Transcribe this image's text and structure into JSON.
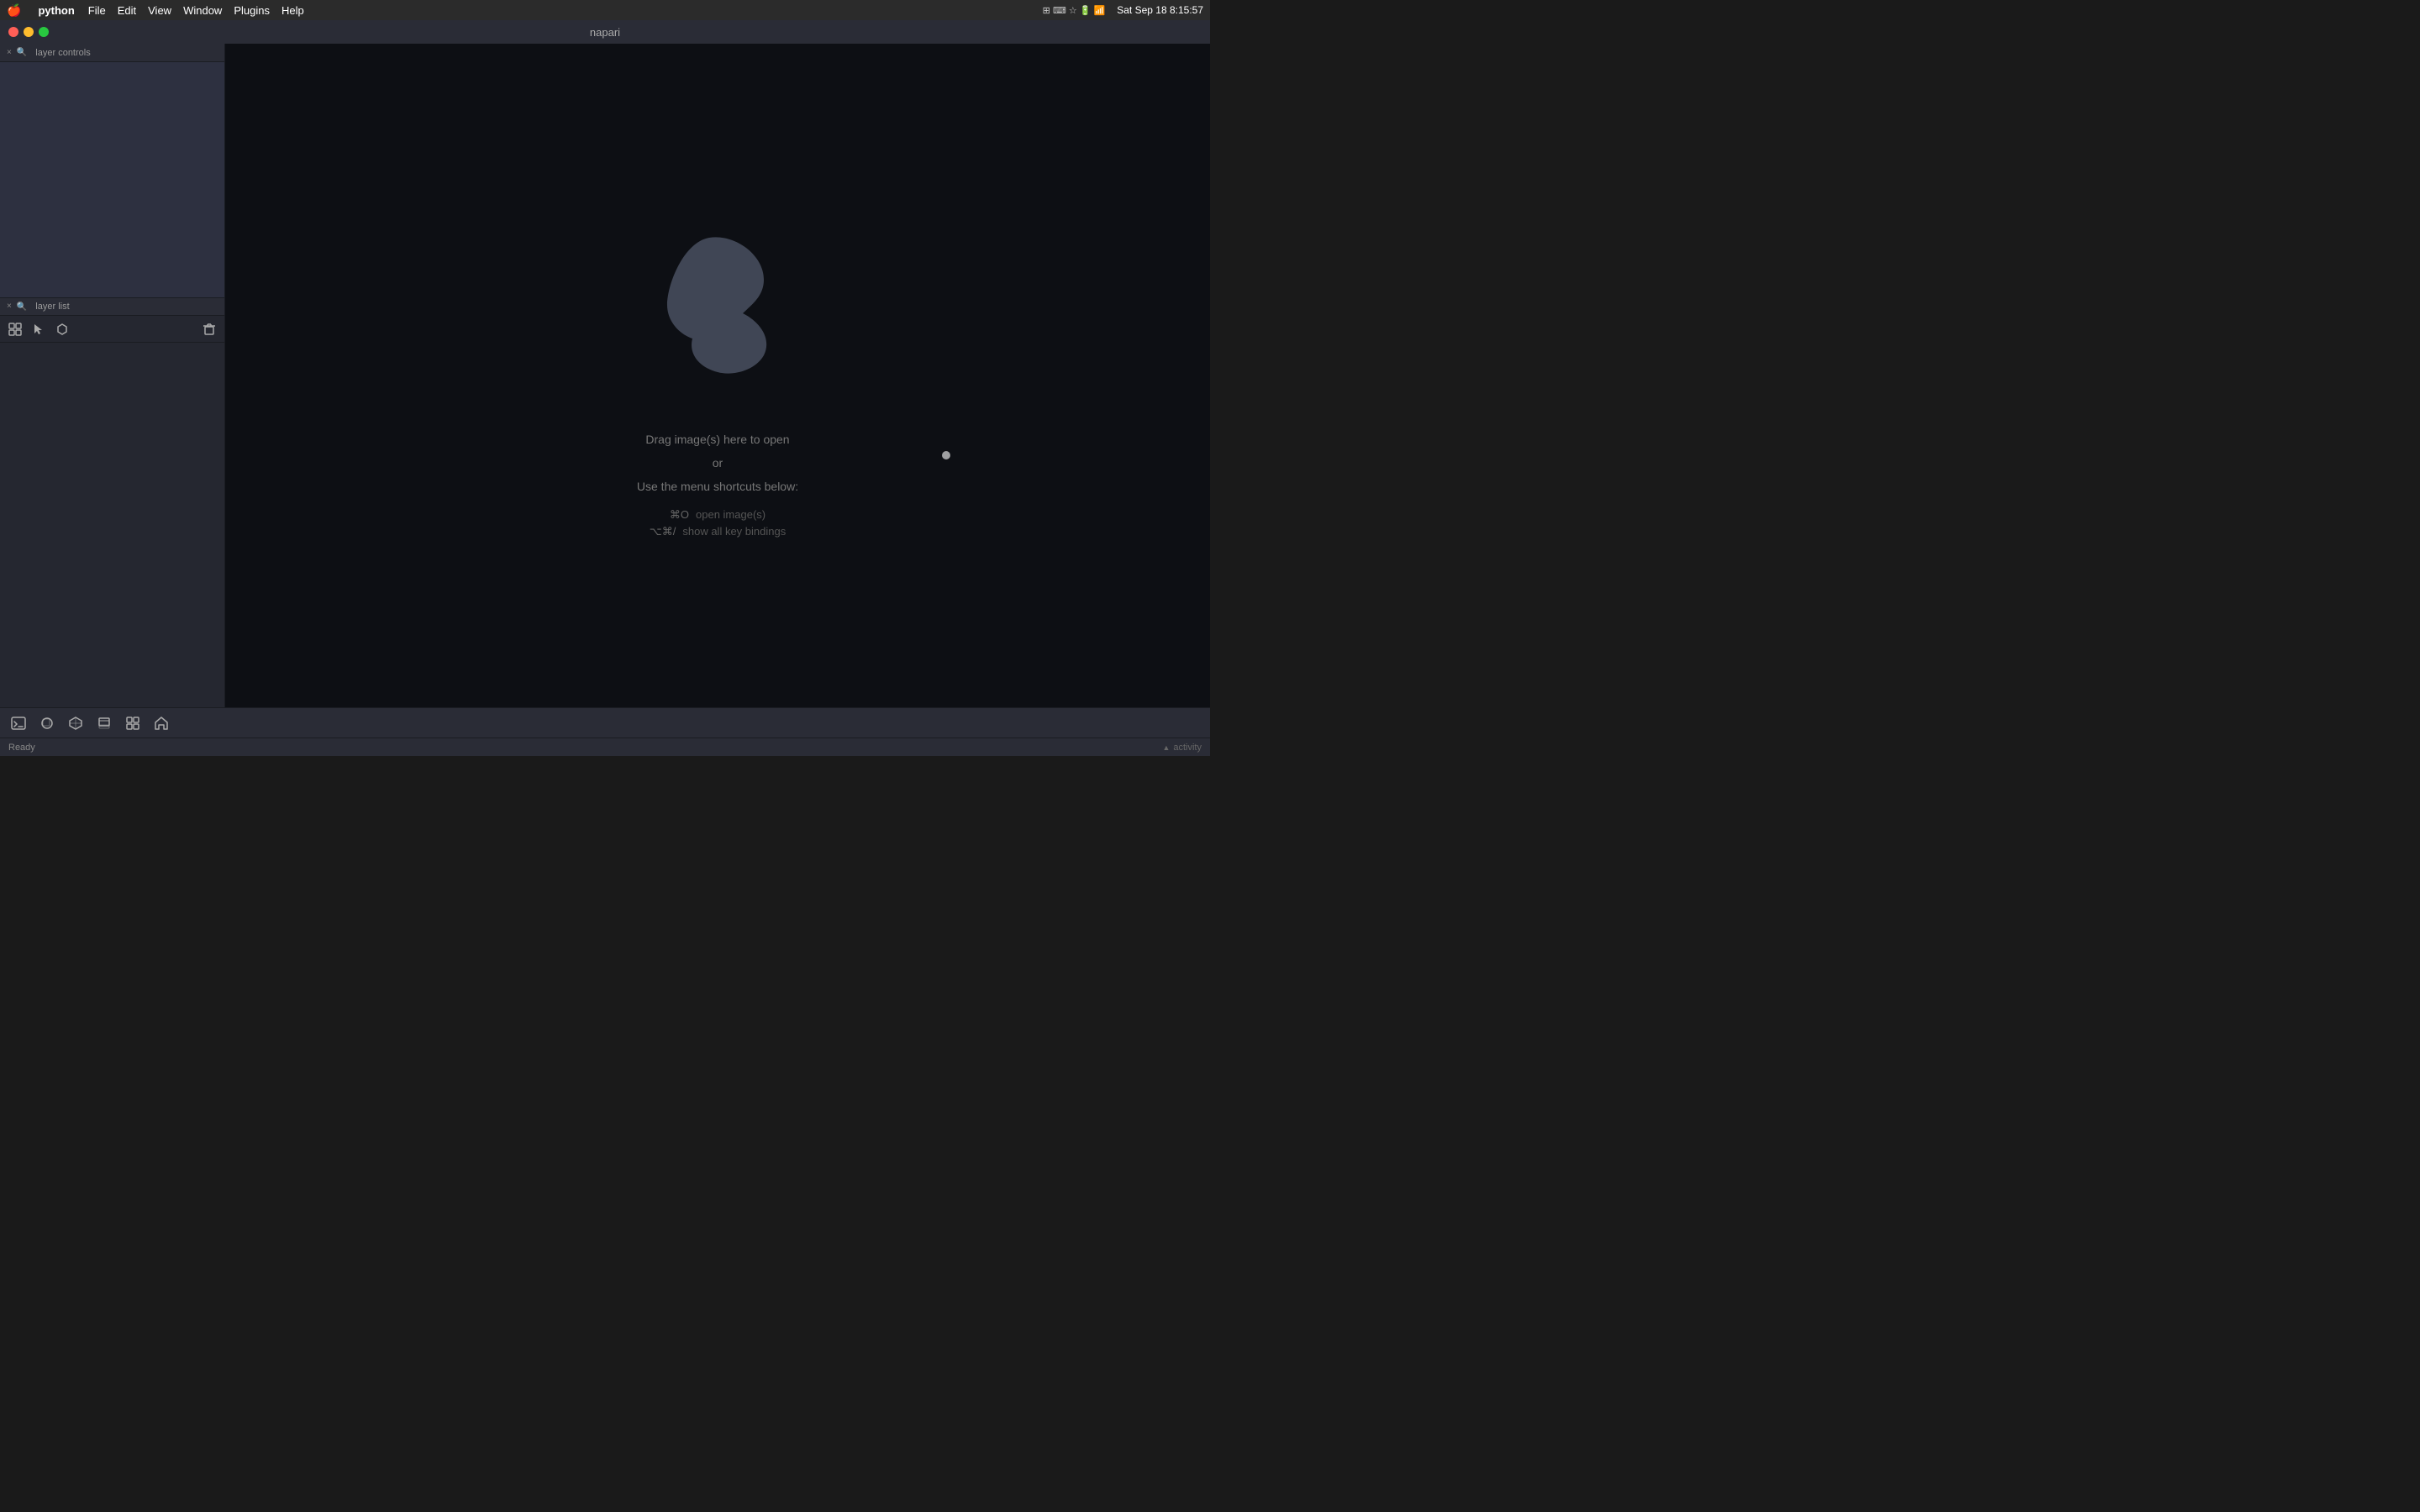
{
  "menubar": {
    "apple": "🍎",
    "app_name": "python",
    "items": [
      "File",
      "Edit",
      "View",
      "Window",
      "Plugins",
      "Help"
    ],
    "right": {
      "datetime": "Sat Sep 18  8:15:57",
      "icons": [
        "battery",
        "wifi",
        "bluetooth",
        "search",
        "notification",
        "display"
      ]
    }
  },
  "titlebar": {
    "title": "napari",
    "controls": {
      "close": "×",
      "minimize": "–",
      "maximize": "+"
    }
  },
  "sidebar": {
    "layer_controls": {
      "header_title": "layer controls",
      "close_icon": "×",
      "search_icon": "🔍"
    },
    "layer_list": {
      "header_title": "layer list",
      "close_icon": "×",
      "search_icon": "🔍",
      "toolbar": {
        "grid_btn": "⊞",
        "arrow_btn": "↖",
        "tag_btn": "⬡",
        "trash_btn": "🗑"
      }
    }
  },
  "canvas": {
    "drag_text": "Drag image(s) here to open",
    "or_text": "or",
    "menu_text": "Use the menu shortcuts below:",
    "shortcuts": [
      {
        "key": "⌘O",
        "desc": "open image(s)"
      },
      {
        "key": "⌥⌘/",
        "desc": "show all key bindings"
      }
    ]
  },
  "bottom_toolbar": {
    "buttons": [
      {
        "id": "terminal",
        "icon": ">_",
        "label": "terminal"
      },
      {
        "id": "shapes",
        "icon": "◈",
        "label": "shapes"
      },
      {
        "id": "cube",
        "icon": "⬡",
        "label": "cube"
      },
      {
        "id": "layers",
        "icon": "⧉",
        "label": "layers"
      },
      {
        "id": "apps",
        "icon": "⊞",
        "label": "apps"
      },
      {
        "id": "home",
        "icon": "⌂",
        "label": "home"
      }
    ]
  },
  "statusbar": {
    "status": "Ready",
    "activity_label": "activity",
    "activity_icon": "▲"
  }
}
